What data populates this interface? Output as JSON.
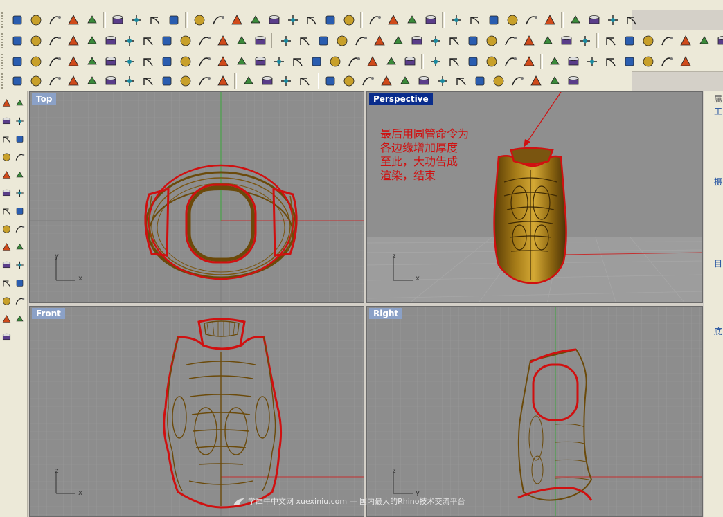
{
  "viewports": {
    "top": {
      "title": "Top",
      "axis_x": "x",
      "axis_y": "y"
    },
    "perspective": {
      "title": "Perspective",
      "axis_x": "x",
      "axis_z": "z"
    },
    "front": {
      "title": "Front",
      "axis_x": "x",
      "axis_z": "z"
    },
    "right": {
      "title": "Right",
      "axis_y": "y",
      "axis_z": "z"
    }
  },
  "annotation": {
    "lines": [
      "最后用圆管命令为",
      "各边缘增加厚度",
      "至此，大功告成",
      "渲染，结束"
    ]
  },
  "watermark": {
    "text": "学犀牛中文网 xuexiniu.com  — 国内最大的Rhino技术交流平台"
  },
  "right_panel": {
    "labels": [
      "属",
      "工",
      "摄",
      "目",
      "底"
    ]
  },
  "toolbar_rows": {
    "row1_icons": [
      "new-file-icon",
      "open-file-icon",
      "save-icon",
      "print-icon",
      "import-icon",
      "cut-icon",
      "copy-icon",
      "paste-icon",
      "undo-icon",
      "pan-hand-icon",
      "rotate-view-icon",
      "zoom-icon",
      "zoom-window-icon",
      "zoom-extents-icon",
      "zoom-selected-icon",
      "undo-view-icon",
      "four-viewports-icon",
      "car-icon",
      "grid-plane-icon",
      "snap-point-icon",
      "object-snap-icon",
      "light-bulb-icon",
      "lock-icon",
      "render-shade-icon",
      "color-wheel-icon",
      "wire-sphere-icon",
      "wire-sphere-grid-icon",
      "render-sphere-icon",
      "arrow-flag-icon",
      "settings-gear-icon",
      "grid-nodes-icon",
      "help-icon"
    ],
    "row2_icons": [
      "curve-a-icon",
      "curve-b-icon",
      "curve-c-icon",
      "curve-d-icon",
      "curve-e-icon",
      "curve-f-icon",
      "curve-g-icon",
      "curve-h-icon",
      "curve-i-icon",
      "curve-j-icon",
      "curve-k-icon",
      "man-tool-icon",
      "man-tool-b-icon",
      "fit-curve-icon",
      "deg-curve-icon",
      "fair-curve-icon",
      "point-tool-icon",
      "grid-points-icon",
      "points-icon",
      "dots-icon",
      "curve-end-icon",
      "polyline-icon",
      "point-on-curve-icon",
      "point-bars-icon",
      "point-stack-icon",
      "point-arrow-icon",
      "wave-icon",
      "pen-point-icon",
      "control-points-icon",
      "arrow-points-icon",
      "hook-icon",
      "curve-kink-icon",
      "blob-icon",
      "cylinder-solid-icon",
      "cylinder-tool-icon",
      "plane-surface-icon",
      "plane-surface-b-icon",
      "box-solid-icon",
      "box-offset-icon",
      "box-stack-icon"
    ],
    "row3_icons": [
      "surface-a-icon",
      "surface-b-icon",
      "surface-c-icon",
      "surface-d-icon",
      "surface-e-icon",
      "surface-f-icon",
      "surface-g-icon",
      "surface-h-icon",
      "surface-i-icon",
      "surface-j-icon",
      "surface-k-icon",
      "surface-l-icon",
      "fit-surface-icon",
      "deg-surface-icon",
      "ctrl-grid-icon",
      "surface-grid-icon",
      "surface-point-icon",
      "cylinder-icon",
      "cylinder-b-icon",
      "edge-pen-icon",
      "satellite-icon",
      "pen-red-icon",
      "surface-bars-icon",
      "surface-stack-icon",
      "surface-arrow-icon",
      "curve-point-icon",
      "step-icon",
      "node-tree-icon",
      "blend-icon",
      "box-mesh-icon",
      "box-bars-icon",
      "diamond-icon",
      "blend-surface-icon",
      "cone-surface-icon",
      "tree-arrow-icon",
      "node-edit-icon"
    ],
    "row4_icons": [
      "solid-a-icon",
      "solid-b-icon",
      "solid-c-icon",
      "solid-d-icon",
      "solid-e-icon",
      "solid-f-icon",
      "solid-g-icon",
      "solid-h-icon",
      "solid-i-icon",
      "solid-j-icon",
      "solid-k-icon",
      "solid-l-icon",
      "solid-m-icon",
      "solid-n-icon",
      "solid-o-icon",
      "solid-p-icon",
      "solid-q-icon",
      "box-primitive-icon",
      "sphere-primitive-icon",
      "ellipsoid-icon",
      "paraboloid-icon",
      "cone-icon",
      "pyramid-icon",
      "truncated-cone-icon",
      "cylinder-primitive-icon",
      "tube-icon",
      "torus-icon",
      "pipe-icon",
      "pipe-b-icon",
      "extrude-icon",
      "extrude-b-icon"
    ],
    "left_icons": [
      "dot-icon",
      "dots-line-icon",
      "rect-points-icon",
      "circle-points-icon",
      "rect-icon",
      "curve-arc-icon",
      "curve-fillet-icon",
      "surface-loft-icon",
      "surface-sweep-icon",
      "solid-box-icon",
      "solid-sphere-icon",
      "surface-patch-icon",
      "surface-flag-icon",
      "trim-icon",
      "split-icon",
      "dot-node-icon",
      "mesh-icon",
      "transform-icon",
      "rotate-icon",
      "scale-icon",
      "dimension-icon",
      "mirror-icon",
      "array-icon",
      "analyze-icon",
      "render-icon",
      "layer-icon",
      "flatten-icon"
    ]
  }
}
